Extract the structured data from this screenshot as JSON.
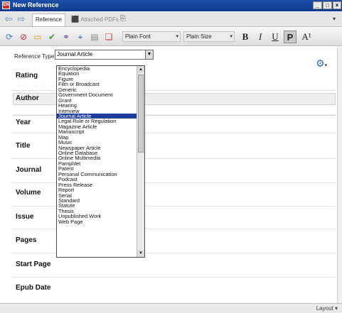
{
  "window": {
    "title": "New Reference",
    "app_icon_text": "EN",
    "controls": {
      "minimize": "_",
      "maximize": "□",
      "close": "×"
    }
  },
  "tabs": [
    {
      "label": "Reference",
      "active": true
    },
    {
      "label": "Attached PDFs",
      "active": false
    }
  ],
  "tab_extra_icon": "paperclip-icon",
  "toolbar": {
    "font": "Plain Font",
    "size": "Plain Size",
    "bold": "B",
    "italic": "I",
    "underline": "U",
    "plain": "P",
    "superscript": "A¹"
  },
  "reference_type": {
    "label": "Reference Type:",
    "value": "Journal Article"
  },
  "dropdown": {
    "selected": "Journal Article",
    "options": [
      "Encyclopedia",
      "Equation",
      "Figure",
      "Film or Broadcast",
      "Generic",
      "Government Document",
      "Grant",
      "Hearing",
      "Interview",
      "Journal Article",
      "Legal Rule or Regulation",
      "Magazine Article",
      "Manuscript",
      "Map",
      "Music",
      "Newspaper Article",
      "Online Database",
      "Online Multimedia",
      "Pamphlet",
      "Patent",
      "Personal Communication",
      "Podcast",
      "Press Release",
      "Report",
      "Serial",
      "Standard",
      "Statute",
      "Thesis",
      "Unpublished Work",
      "Web Page"
    ]
  },
  "fields": {
    "rating": "Rating",
    "author": "Author",
    "year": "Year",
    "title": "Title",
    "journal": "Journal",
    "volume": "Volume",
    "issue": "Issue",
    "pages": "Pages",
    "start_page": "Start Page",
    "epub_date": "Epub Date"
  },
  "status_bar": {
    "layout": "Layout"
  },
  "colors": {
    "titlebar": "#1c4fa8",
    "selection": "#1f3f9e",
    "accent": "#2d6ab8"
  }
}
